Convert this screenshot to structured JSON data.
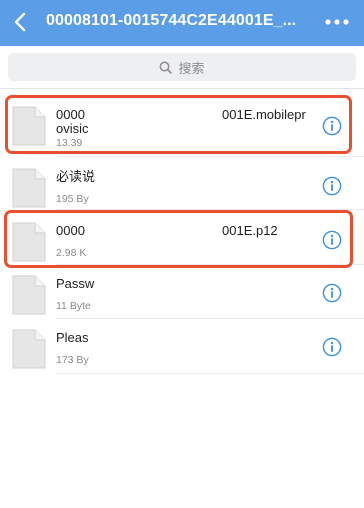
{
  "nav": {
    "title": "00008101-0015744C2E44001E_...",
    "back_icon": "chevron-left-icon",
    "more_icon": "ellipsis-icon"
  },
  "search": {
    "placeholder": "搜索"
  },
  "files": [
    {
      "name_line1": "0000",
      "name_line2": "ovisic",
      "ext": "001E.mobilepr",
      "size": "13.39"
    },
    {
      "name_line1": "必读说",
      "name_line2": "",
      "ext": "",
      "size": "195 By"
    },
    {
      "name_line1": "0000",
      "name_line2": "",
      "ext": "001E.p12",
      "size": "2.98 K"
    },
    {
      "name_line1": "Passw",
      "name_line2": "",
      "ext": "",
      "size": "11 Byte"
    },
    {
      "name_line1": "Pleas",
      "name_line2": "",
      "ext": "",
      "size": "173 By"
    }
  ],
  "colors": {
    "nav_bg": "#5b9de6",
    "highlight": "#e8502f",
    "info": "#3d8fe0"
  }
}
